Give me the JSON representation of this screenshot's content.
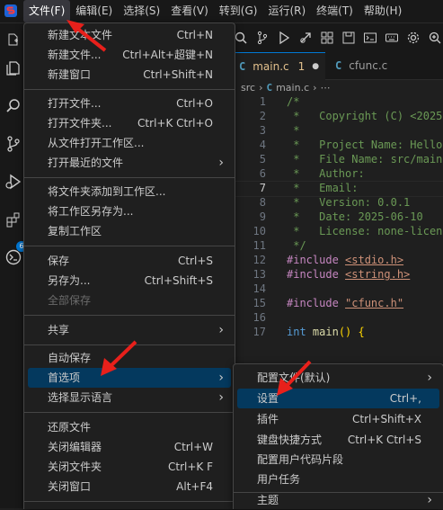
{
  "menubar": {
    "items": [
      "文件(F)",
      "编辑(E)",
      "选择(S)",
      "查看(V)",
      "转到(G)",
      "运行(R)",
      "终端(T)",
      "帮助(H)"
    ]
  },
  "tabs": [
    {
      "label": "main.c",
      "modified": "1"
    },
    {
      "label": "cfunc.c"
    }
  ],
  "breadcrumb": {
    "folder": "src",
    "file": "main.c",
    "more": "⋯"
  },
  "activity": {
    "badge": "6"
  },
  "file_menu": {
    "items": [
      {
        "label": "新建文本文件",
        "shortcut": "Ctrl+N"
      },
      {
        "label": "新建文件...",
        "shortcut": "Ctrl+Alt+超键+N"
      },
      {
        "label": "新建窗口",
        "shortcut": "Ctrl+Shift+N"
      },
      {
        "label": "打开文件...",
        "shortcut": "Ctrl+O"
      },
      {
        "label": "打开文件夹...",
        "shortcut": "Ctrl+K Ctrl+O"
      },
      {
        "label": "从文件打开工作区..."
      },
      {
        "label": "打开最近的文件"
      },
      {
        "label": "将文件夹添加到工作区..."
      },
      {
        "label": "将工作区另存为..."
      },
      {
        "label": "复制工作区"
      },
      {
        "label": "保存",
        "shortcut": "Ctrl+S"
      },
      {
        "label": "另存为...",
        "shortcut": "Ctrl+Shift+S"
      },
      {
        "label": "全部保存"
      },
      {
        "label": "共享"
      },
      {
        "label": "自动保存"
      },
      {
        "label": "首选项"
      },
      {
        "label": "选择显示语言"
      },
      {
        "label": "还原文件"
      },
      {
        "label": "关闭编辑器",
        "shortcut": "Ctrl+W"
      },
      {
        "label": "关闭文件夹",
        "shortcut": "Ctrl+K F"
      },
      {
        "label": "关闭窗口",
        "shortcut": "Alt+F4"
      }
    ]
  },
  "prefs_menu": {
    "items": [
      {
        "label": "配置文件(默认)"
      },
      {
        "label": "设置",
        "shortcut": "Ctrl+,"
      },
      {
        "label": "插件",
        "shortcut": "Ctrl+Shift+X"
      },
      {
        "label": "键盘快捷方式",
        "shortcut": "Ctrl+K Ctrl+S"
      },
      {
        "label": "配置用户代码片段"
      },
      {
        "label": "用户任务"
      },
      {
        "label": "主题"
      }
    ]
  },
  "editor": {
    "lines": [
      {
        "n": "1",
        "text": "/*"
      },
      {
        "n": "2",
        "text": " *   Copyright (C) <2025"
      },
      {
        "n": "3",
        "text": " *"
      },
      {
        "n": "4",
        "text": " *   Project Name: Hello"
      },
      {
        "n": "5",
        "text": " *   File Name: src/main"
      },
      {
        "n": "6",
        "text": " *   Author:"
      },
      {
        "n": "7",
        "text": " *   Email:"
      },
      {
        "n": "8",
        "text": " *   Version: 0.0.1"
      },
      {
        "n": "9",
        "text": " *   Date: 2025-06-10"
      },
      {
        "n": "10",
        "text": " *   License: none-licen"
      },
      {
        "n": "11",
        "text": " */"
      },
      {
        "n": "12",
        "kw": "#include ",
        "str": "<stdio.h>"
      },
      {
        "n": "13",
        "kw": "#include ",
        "str": "<string.h>"
      },
      {
        "n": "14"
      },
      {
        "n": "15",
        "kw": "#include ",
        "str": "\"cfunc.h\""
      },
      {
        "n": "16"
      },
      {
        "n": "17",
        "ty": "int ",
        "fn": "main",
        "pn": "() {"
      }
    ]
  },
  "colors": {
    "accent": "#0078d4",
    "highlight": "#04395e",
    "arrow": "#e8201b"
  }
}
